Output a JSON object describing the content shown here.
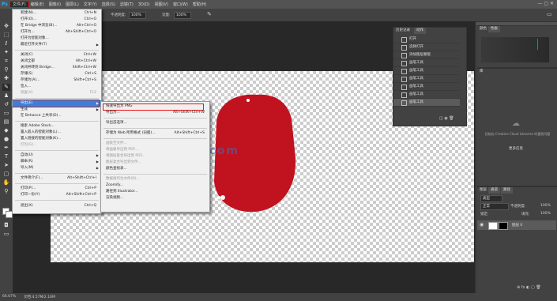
{
  "menubar": {
    "logo": "Ps",
    "items": [
      "文件(F)",
      "编辑(E)",
      "图像(I)",
      "图层(L)",
      "文字(Y)",
      "选择(S)",
      "滤镜(T)",
      "3D(D)",
      "视图(V)",
      "窗口(W)",
      "帮助(H)"
    ]
  },
  "options": {
    "opacity_label": "不透明度:",
    "opacity_value": "100%",
    "flow_label": "流量:",
    "flow_value": "100%"
  },
  "file_menu": {
    "items": [
      {
        "label": "新建(N)...",
        "shortcut": "Ctrl+N"
      },
      {
        "label": "打开(O)...",
        "shortcut": "Ctrl+O"
      },
      {
        "label": "在 Bridge 中浏览(B)...",
        "shortcut": "Alt+Ctrl+O"
      },
      {
        "label": "打开为...",
        "shortcut": "Alt+Shift+Ctrl+O"
      },
      {
        "label": "打开为智能对象...",
        "shortcut": ""
      },
      {
        "label": "最近打开文件(T)",
        "shortcut": "",
        "submenu": true
      },
      {
        "label": "关闭(C)",
        "shortcut": "Ctrl+W"
      },
      {
        "label": "关闭全部",
        "shortcut": "Alt+Ctrl+W"
      },
      {
        "label": "关闭并转到 Bridge...",
        "shortcut": "Shift+Ctrl+W"
      },
      {
        "label": "存储(S)",
        "shortcut": "Ctrl+S"
      },
      {
        "label": "存储为(A)...",
        "shortcut": "Shift+Ctrl+S"
      },
      {
        "label": "签入...",
        "shortcut": ""
      },
      {
        "label": "恢复(V)",
        "shortcut": "F12",
        "disabled": true
      },
      {
        "label": "导出(E)",
        "shortcut": "",
        "submenu": true,
        "highlighted": true
      },
      {
        "label": "生成",
        "shortcut": "",
        "submenu": true
      },
      {
        "label": "在 Behance 上共享(D)...",
        "shortcut": ""
      },
      {
        "label": "搜索 Adobe Stock...",
        "shortcut": ""
      },
      {
        "label": "置入嵌入的智能对象(L)...",
        "shortcut": ""
      },
      {
        "label": "置入链接的智能对象(K)...",
        "shortcut": ""
      },
      {
        "label": "打包(G)...",
        "shortcut": "",
        "disabled": true
      },
      {
        "label": "自动(U)",
        "shortcut": "",
        "submenu": true
      },
      {
        "label": "脚本(R)",
        "shortcut": "",
        "submenu": true
      },
      {
        "label": "导入(M)",
        "shortcut": "",
        "submenu": true
      },
      {
        "label": "文件简介(F)...",
        "shortcut": "Alt+Shift+Ctrl+I"
      },
      {
        "label": "打印(P)...",
        "shortcut": "Ctrl+P"
      },
      {
        "label": "打印一份(Y)",
        "shortcut": "Alt+Shift+Ctrl+P"
      },
      {
        "label": "退出(X)",
        "shortcut": "Ctrl+Q"
      }
    ]
  },
  "export_menu": {
    "items": [
      {
        "label": "快速导出为 PNG",
        "shortcut": ""
      },
      {
        "label": "导出为...",
        "shortcut": "Alt+Shift+Ctrl+W"
      },
      {
        "label": "导出首选项...",
        "shortcut": ""
      },
      {
        "label": "存储为 Web 所用格式 (旧版)...",
        "shortcut": "Alt+Shift+Ctrl+S"
      },
      {
        "label": "画板至文件...",
        "shortcut": "",
        "disabled": true
      },
      {
        "label": "将画板导出到 PDF...",
        "shortcut": "",
        "disabled": true
      },
      {
        "label": "将图层复合导出到 PDF...",
        "shortcut": "",
        "disabled": true
      },
      {
        "label": "图层复合导出到文件...",
        "shortcut": "",
        "disabled": true
      },
      {
        "label": "颜色查找表...",
        "shortcut": ""
      },
      {
        "label": "数据组作为文件(D)...",
        "shortcut": "",
        "disabled": true
      },
      {
        "label": "Zoomify...",
        "shortcut": ""
      },
      {
        "label": "路径到 Illustrator...",
        "shortcut": ""
      },
      {
        "label": "渲染视频...",
        "shortcut": ""
      }
    ]
  },
  "history_panel": {
    "tabs": [
      "历史记录",
      "动作"
    ],
    "items": [
      "打开",
      "选择打开",
      "添加图层蒙版",
      "画笔工具",
      "画笔工具",
      "画笔工具",
      "画笔工具",
      "画笔工具",
      "画笔工具"
    ]
  },
  "color_panel": {
    "tabs": [
      "颜色",
      "色板"
    ]
  },
  "libraries_panel": {
    "tab": "库",
    "message": "初始化 Creative Cloud Libraries 时遇到问题",
    "link": "更多信息"
  },
  "layers_panel": {
    "tabs": [
      "图层",
      "通道",
      "路径"
    ],
    "kind_label": "类型",
    "blend_mode": "正常",
    "opacity_label": "不透明度:",
    "opacity_value": "100%",
    "lock_label": "锁定:",
    "fill_label": "填充:",
    "fill_value": "100%",
    "layer_name": "图层 0"
  },
  "watermark": "www.psahz.com",
  "status": {
    "zoom": "66.67%",
    "doc": "文档:4.57M/2.16M"
  },
  "colors": {
    "accent": "#3b80d8",
    "highlight_box": "#e11111",
    "shape_red": "#c1121f"
  }
}
